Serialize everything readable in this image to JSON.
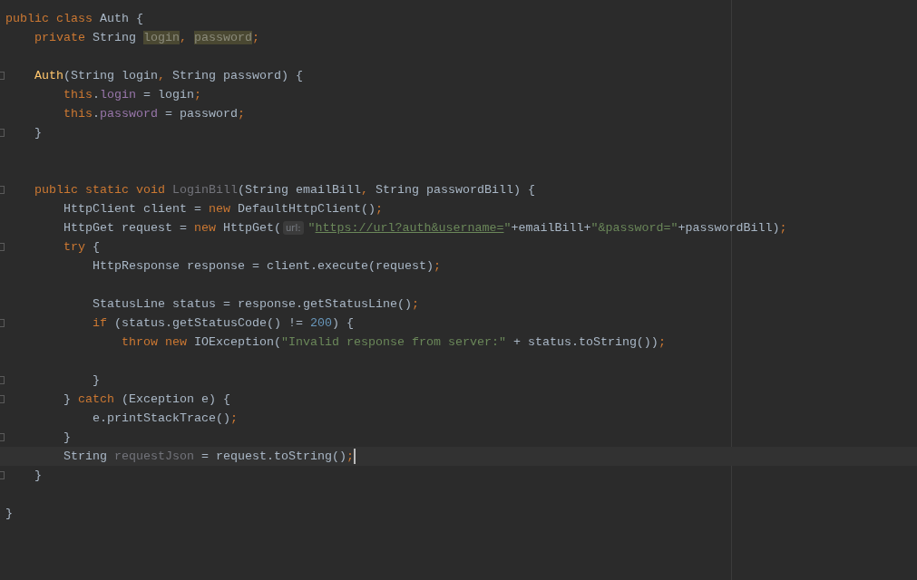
{
  "editor": {
    "lines": [
      {
        "kind": "code",
        "fold": false,
        "current": false,
        "tokens": [
          {
            "text": "public class",
            "kind": "keyword"
          },
          {
            "text": " Auth {",
            "kind": "plain"
          }
        ]
      },
      {
        "kind": "code",
        "fold": false,
        "current": false,
        "tokens": [
          {
            "text": "    private",
            "kind": "keyword"
          },
          {
            "text": " String ",
            "kind": "plain"
          },
          {
            "text": "login",
            "kind": "highlight"
          },
          {
            "text": ", ",
            "kind": "keyword"
          },
          {
            "text": "password",
            "kind": "highlight"
          },
          {
            "text": ";",
            "kind": "keyword"
          }
        ]
      },
      {
        "kind": "blank"
      },
      {
        "kind": "code",
        "fold": true,
        "current": false,
        "tokens": [
          {
            "text": "    Auth",
            "kind": "declaration"
          },
          {
            "text": "(String login",
            "kind": "plain"
          },
          {
            "text": ", ",
            "kind": "keyword"
          },
          {
            "text": "String password) {",
            "kind": "plain"
          }
        ]
      },
      {
        "kind": "code",
        "fold": false,
        "current": false,
        "tokens": [
          {
            "text": "        this",
            "kind": "keyword"
          },
          {
            "text": ".",
            "kind": "plain"
          },
          {
            "text": "login",
            "kind": "field"
          },
          {
            "text": " = login",
            "kind": "plain"
          },
          {
            "text": ";",
            "kind": "keyword"
          }
        ]
      },
      {
        "kind": "code",
        "fold": false,
        "current": false,
        "tokens": [
          {
            "text": "        this",
            "kind": "keyword"
          },
          {
            "text": ".",
            "kind": "plain"
          },
          {
            "text": "password",
            "kind": "field"
          },
          {
            "text": " = password",
            "kind": "plain"
          },
          {
            "text": ";",
            "kind": "keyword"
          }
        ]
      },
      {
        "kind": "code",
        "fold": true,
        "current": false,
        "tokens": [
          {
            "text": "    }",
            "kind": "plain"
          }
        ]
      },
      {
        "kind": "blank"
      },
      {
        "kind": "blank"
      },
      {
        "kind": "code",
        "fold": true,
        "current": false,
        "tokens": [
          {
            "text": "    public static void ",
            "kind": "keyword"
          },
          {
            "text": "LoginBill",
            "kind": "unused"
          },
          {
            "text": "(String emailBill",
            "kind": "plain"
          },
          {
            "text": ", ",
            "kind": "keyword"
          },
          {
            "text": "String passwordBill) {",
            "kind": "plain"
          }
        ]
      },
      {
        "kind": "code",
        "fold": false,
        "current": false,
        "tokens": [
          {
            "text": "        HttpClient client = ",
            "kind": "plain"
          },
          {
            "text": "new",
            "kind": "keyword"
          },
          {
            "text": " DefaultHttpClient()",
            "kind": "plain"
          },
          {
            "text": ";",
            "kind": "keyword"
          }
        ]
      },
      {
        "kind": "code",
        "fold": false,
        "current": false,
        "tokens": [
          {
            "text": "        HttpGet request = ",
            "kind": "plain"
          },
          {
            "text": "new",
            "kind": "keyword"
          },
          {
            "text": " HttpGet(",
            "kind": "plain"
          },
          {
            "text": "url:",
            "kind": "hint"
          },
          {
            "text": "\"",
            "kind": "string"
          },
          {
            "text": "https://url?auth&username=",
            "kind": "url"
          },
          {
            "text": "\"",
            "kind": "string"
          },
          {
            "text": "+emailBill+",
            "kind": "plain"
          },
          {
            "text": "\"&password=\"",
            "kind": "string"
          },
          {
            "text": "+passwordBill)",
            "kind": "plain"
          },
          {
            "text": ";",
            "kind": "keyword"
          }
        ]
      },
      {
        "kind": "code",
        "fold": true,
        "current": false,
        "tokens": [
          {
            "text": "        try",
            "kind": "keyword"
          },
          {
            "text": " {",
            "kind": "plain"
          }
        ]
      },
      {
        "kind": "code",
        "fold": false,
        "current": false,
        "tokens": [
          {
            "text": "            HttpResponse response = client.execute(request)",
            "kind": "plain"
          },
          {
            "text": ";",
            "kind": "keyword"
          }
        ]
      },
      {
        "kind": "blank"
      },
      {
        "kind": "code",
        "fold": false,
        "current": false,
        "tokens": [
          {
            "text": "            StatusLine status = response.getStatusLine()",
            "kind": "plain"
          },
          {
            "text": ";",
            "kind": "keyword"
          }
        ]
      },
      {
        "kind": "code",
        "fold": true,
        "current": false,
        "tokens": [
          {
            "text": "            if",
            "kind": "keyword"
          },
          {
            "text": " (status.getStatusCode() != ",
            "kind": "plain"
          },
          {
            "text": "200",
            "kind": "number"
          },
          {
            "text": ") {",
            "kind": "plain"
          }
        ]
      },
      {
        "kind": "code",
        "fold": false,
        "current": false,
        "tokens": [
          {
            "text": "                throw new",
            "kind": "keyword"
          },
          {
            "text": " IOException(",
            "kind": "plain"
          },
          {
            "text": "\"Invalid response from server:\"",
            "kind": "string"
          },
          {
            "text": " + status.toString())",
            "kind": "plain"
          },
          {
            "text": ";",
            "kind": "keyword"
          }
        ]
      },
      {
        "kind": "blank"
      },
      {
        "kind": "code",
        "fold": true,
        "current": false,
        "tokens": [
          {
            "text": "            }",
            "kind": "plain"
          }
        ]
      },
      {
        "kind": "code",
        "fold": true,
        "current": false,
        "tokens": [
          {
            "text": "        } ",
            "kind": "plain"
          },
          {
            "text": "catch",
            "kind": "keyword"
          },
          {
            "text": " (Exception e) {",
            "kind": "plain"
          }
        ]
      },
      {
        "kind": "code",
        "fold": false,
        "current": false,
        "tokens": [
          {
            "text": "            e.printStackTrace()",
            "kind": "plain"
          },
          {
            "text": ";",
            "kind": "keyword"
          }
        ]
      },
      {
        "kind": "code",
        "fold": true,
        "current": false,
        "tokens": [
          {
            "text": "        }",
            "kind": "plain"
          }
        ]
      },
      {
        "kind": "code",
        "fold": false,
        "current": true,
        "tokens": [
          {
            "text": "        String ",
            "kind": "plain"
          },
          {
            "text": "requestJson",
            "kind": "unused"
          },
          {
            "text": " = request.toString()",
            "kind": "plain"
          },
          {
            "text": ";",
            "kind": "keyword"
          }
        ]
      },
      {
        "kind": "code",
        "fold": true,
        "current": false,
        "tokens": [
          {
            "text": "    }",
            "kind": "plain"
          }
        ]
      },
      {
        "kind": "blank"
      },
      {
        "kind": "code",
        "fold": false,
        "current": false,
        "tokens": [
          {
            "text": "}",
            "kind": "plain"
          }
        ]
      }
    ]
  }
}
